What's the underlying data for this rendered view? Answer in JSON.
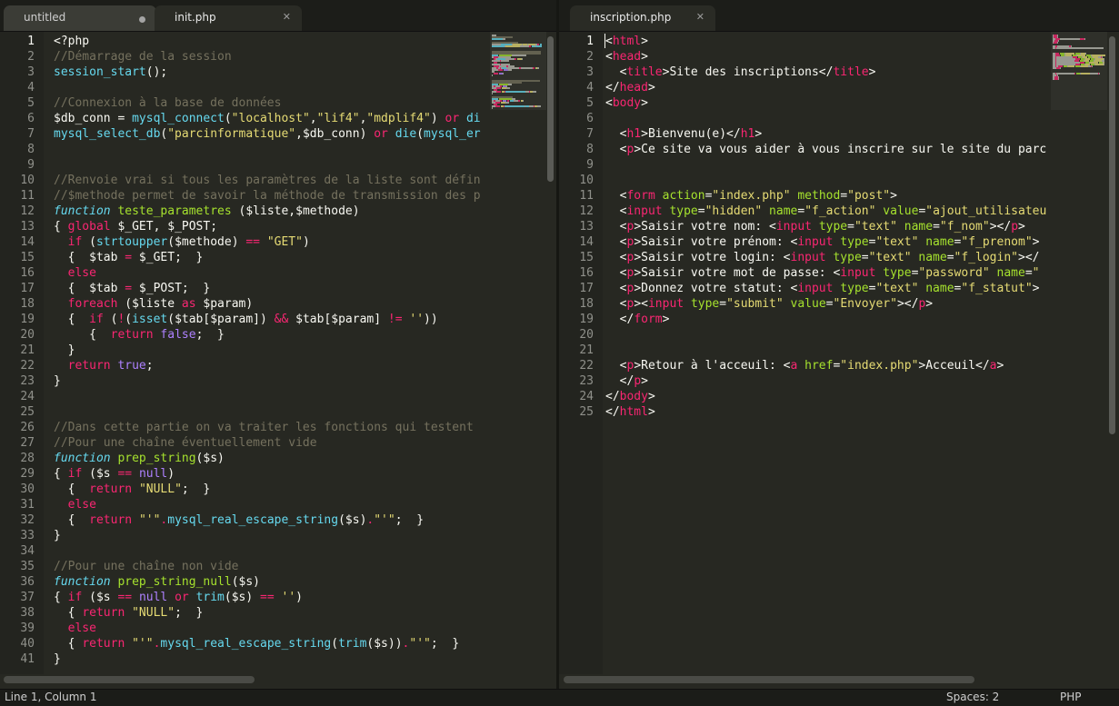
{
  "left_pane": {
    "tabs": [
      {
        "title": "untitled",
        "state": "modified"
      },
      {
        "title": "init.php",
        "state": "active"
      }
    ],
    "first_line": 1,
    "current_line": 1,
    "lines": [
      [
        [
          "t",
          "<?php"
        ]
      ],
      [
        [
          "cm",
          "//Démarrage de la session"
        ]
      ],
      [
        [
          "bi",
          "session_start"
        ],
        [
          "t",
          "();"
        ]
      ],
      [],
      [
        [
          "cm",
          "//Connexion à la base de données"
        ]
      ],
      [
        [
          "t",
          "$db_conn = "
        ],
        [
          "bi",
          "mysql_connect"
        ],
        [
          "t",
          "("
        ],
        [
          "st",
          "\"localhost\""
        ],
        [
          "t",
          ","
        ],
        [
          "st",
          "\"lif4\""
        ],
        [
          "t",
          ","
        ],
        [
          "st",
          "\"mdplif4\""
        ],
        [
          "t",
          ") "
        ],
        [
          "kw",
          "or"
        ],
        [
          "t",
          " "
        ],
        [
          "bi",
          "di"
        ]
      ],
      [
        [
          "bi",
          "mysql_select_db"
        ],
        [
          "t",
          "("
        ],
        [
          "st",
          "\"parcinformatique\""
        ],
        [
          "t",
          ",$db_conn) "
        ],
        [
          "kw",
          "or"
        ],
        [
          "t",
          " "
        ],
        [
          "bi",
          "die"
        ],
        [
          "t",
          "("
        ],
        [
          "bi",
          "mysql_er"
        ]
      ],
      [],
      [],
      [
        [
          "cm",
          "//Renvoie vrai si tous les paramètres de la liste sont défin"
        ]
      ],
      [
        [
          "cm",
          "//$methode permet de savoir la méthode de transmission des p"
        ]
      ],
      [
        [
          "bi it",
          "function"
        ],
        [
          "t",
          " "
        ],
        [
          "fn",
          "teste_parametres"
        ],
        [
          "t",
          " ($liste,$methode)"
        ]
      ],
      [
        [
          "t",
          "{ "
        ],
        [
          "kw",
          "global"
        ],
        [
          "t",
          " $_GET, $_POST;"
        ]
      ],
      [
        [
          "t",
          "  "
        ],
        [
          "kw",
          "if"
        ],
        [
          "t",
          " ("
        ],
        [
          "bi",
          "strtoupper"
        ],
        [
          "t",
          "($methode) "
        ],
        [
          "kw",
          "=="
        ],
        [
          "t",
          " "
        ],
        [
          "st",
          "\"GET\""
        ],
        [
          "t",
          ")"
        ]
      ],
      [
        [
          "t",
          "  {  $tab "
        ],
        [
          "kw",
          "="
        ],
        [
          "t",
          " $_GET;  }"
        ]
      ],
      [
        [
          "t",
          "  "
        ],
        [
          "kw",
          "else"
        ]
      ],
      [
        [
          "t",
          "  {  $tab "
        ],
        [
          "kw",
          "="
        ],
        [
          "t",
          " $_POST;  }"
        ]
      ],
      [
        [
          "t",
          "  "
        ],
        [
          "kw",
          "foreach"
        ],
        [
          "t",
          " ($liste "
        ],
        [
          "kw",
          "as"
        ],
        [
          "t",
          " $param)"
        ]
      ],
      [
        [
          "t",
          "  {  "
        ],
        [
          "kw",
          "if"
        ],
        [
          "t",
          " ("
        ],
        [
          "kw",
          "!"
        ],
        [
          "t",
          "("
        ],
        [
          "bi",
          "isset"
        ],
        [
          "t",
          "($tab[$param]) "
        ],
        [
          "kw",
          "&&"
        ],
        [
          "t",
          " $tab[$param] "
        ],
        [
          "kw",
          "!="
        ],
        [
          "t",
          " "
        ],
        [
          "st",
          "''"
        ],
        [
          "t",
          "))"
        ]
      ],
      [
        [
          "t",
          "     {  "
        ],
        [
          "kw",
          "return"
        ],
        [
          "t",
          " "
        ],
        [
          "ct",
          "false"
        ],
        [
          "t",
          ";  }"
        ]
      ],
      [
        [
          "t",
          "  }"
        ]
      ],
      [
        [
          "t",
          "  "
        ],
        [
          "kw",
          "return"
        ],
        [
          "t",
          " "
        ],
        [
          "ct",
          "true"
        ],
        [
          "t",
          ";"
        ]
      ],
      [
        [
          "t",
          "}"
        ]
      ],
      [],
      [],
      [
        [
          "cm",
          "//Dans cette partie on va traiter les fonctions qui testent"
        ]
      ],
      [
        [
          "cm",
          "//Pour une chaîne éventuellement vide"
        ]
      ],
      [
        [
          "bi it",
          "function"
        ],
        [
          "t",
          " "
        ],
        [
          "fn",
          "prep_string"
        ],
        [
          "t",
          "($s)"
        ]
      ],
      [
        [
          "t",
          "{ "
        ],
        [
          "kw",
          "if"
        ],
        [
          "t",
          " ($s "
        ],
        [
          "kw",
          "=="
        ],
        [
          "t",
          " "
        ],
        [
          "ct",
          "null"
        ],
        [
          "t",
          ")"
        ]
      ],
      [
        [
          "t",
          "  {  "
        ],
        [
          "kw",
          "return"
        ],
        [
          "t",
          " "
        ],
        [
          "st",
          "\"NULL\""
        ],
        [
          "t",
          ";  }"
        ]
      ],
      [
        [
          "t",
          "  "
        ],
        [
          "kw",
          "else"
        ]
      ],
      [
        [
          "t",
          "  {  "
        ],
        [
          "kw",
          "return"
        ],
        [
          "t",
          " "
        ],
        [
          "st",
          "\"'\""
        ],
        [
          "kw",
          "."
        ],
        [
          "bi",
          "mysql_real_escape_string"
        ],
        [
          "t",
          "($s)"
        ],
        [
          "kw",
          "."
        ],
        [
          "st",
          "\"'\""
        ],
        [
          "t",
          ";  }"
        ]
      ],
      [
        [
          "t",
          "}"
        ]
      ],
      [],
      [
        [
          "cm",
          "//Pour une chaîne non vide"
        ]
      ],
      [
        [
          "bi it",
          "function"
        ],
        [
          "t",
          " "
        ],
        [
          "fn",
          "prep_string_null"
        ],
        [
          "t",
          "($s)"
        ]
      ],
      [
        [
          "t",
          "{ "
        ],
        [
          "kw",
          "if"
        ],
        [
          "t",
          " ($s "
        ],
        [
          "kw",
          "=="
        ],
        [
          "t",
          " "
        ],
        [
          "ct",
          "null"
        ],
        [
          "t",
          " "
        ],
        [
          "kw",
          "or"
        ],
        [
          "t",
          " "
        ],
        [
          "bi",
          "trim"
        ],
        [
          "t",
          "($s) "
        ],
        [
          "kw",
          "=="
        ],
        [
          "t",
          " "
        ],
        [
          "st",
          "''"
        ],
        [
          "t",
          ")"
        ]
      ],
      [
        [
          "t",
          "  { "
        ],
        [
          "kw",
          "return"
        ],
        [
          "t",
          " "
        ],
        [
          "st",
          "\"NULL\""
        ],
        [
          "t",
          ";  }"
        ]
      ],
      [
        [
          "t",
          "  "
        ],
        [
          "kw",
          "else"
        ]
      ],
      [
        [
          "t",
          "  { "
        ],
        [
          "kw",
          "return"
        ],
        [
          "t",
          " "
        ],
        [
          "st",
          "\"'\""
        ],
        [
          "kw",
          "."
        ],
        [
          "bi",
          "mysql_real_escape_string"
        ],
        [
          "t",
          "("
        ],
        [
          "bi",
          "trim"
        ],
        [
          "t",
          "($s))"
        ],
        [
          "kw",
          "."
        ],
        [
          "st",
          "\"'\""
        ],
        [
          "t",
          ";  }"
        ]
      ],
      [
        [
          "t",
          "}"
        ]
      ]
    ]
  },
  "right_pane": {
    "tabs": [
      {
        "title": "inscription.php",
        "state": "active"
      }
    ],
    "first_line": 1,
    "current_line": 1,
    "lines": [
      [
        [
          "t",
          "<"
        ],
        [
          "kw",
          "html"
        ],
        [
          "t",
          ">"
        ]
      ],
      [
        [
          "t",
          "<"
        ],
        [
          "kw",
          "head"
        ],
        [
          "t",
          ">"
        ]
      ],
      [
        [
          "t",
          "  <"
        ],
        [
          "kw",
          "title"
        ],
        [
          "t",
          ">Site des inscriptions</"
        ],
        [
          "kw",
          "title"
        ],
        [
          "t",
          ">"
        ]
      ],
      [
        [
          "t",
          "</"
        ],
        [
          "kw",
          "head"
        ],
        [
          "t",
          ">"
        ]
      ],
      [
        [
          "t",
          "<"
        ],
        [
          "kw",
          "body"
        ],
        [
          "t",
          ">"
        ]
      ],
      [],
      [
        [
          "t",
          "  <"
        ],
        [
          "kw",
          "h1"
        ],
        [
          "t",
          ">Bienvenu(e)</"
        ],
        [
          "kw",
          "h1"
        ],
        [
          "t",
          ">"
        ]
      ],
      [
        [
          "t",
          "  <"
        ],
        [
          "kw",
          "p"
        ],
        [
          "t",
          ">Ce site va vous aider à vous inscrire sur le site du parc"
        ]
      ],
      [],
      [],
      [
        [
          "t",
          "  <"
        ],
        [
          "kw",
          "form"
        ],
        [
          "t",
          " "
        ],
        [
          "at",
          "action"
        ],
        [
          "t",
          "="
        ],
        [
          "st",
          "\"index.php\""
        ],
        [
          "t",
          " "
        ],
        [
          "at",
          "method"
        ],
        [
          "t",
          "="
        ],
        [
          "st",
          "\"post\""
        ],
        [
          "t",
          ">"
        ]
      ],
      [
        [
          "t",
          "  <"
        ],
        [
          "kw",
          "input"
        ],
        [
          "t",
          " "
        ],
        [
          "at",
          "type"
        ],
        [
          "t",
          "="
        ],
        [
          "st",
          "\"hidden\""
        ],
        [
          "t",
          " "
        ],
        [
          "at",
          "name"
        ],
        [
          "t",
          "="
        ],
        [
          "st",
          "\"f_action\""
        ],
        [
          "t",
          " "
        ],
        [
          "at",
          "value"
        ],
        [
          "t",
          "="
        ],
        [
          "st",
          "\"ajout_utilisateu"
        ]
      ],
      [
        [
          "t",
          "  <"
        ],
        [
          "kw",
          "p"
        ],
        [
          "t",
          ">Saisir votre nom: <"
        ],
        [
          "kw",
          "input"
        ],
        [
          "t",
          " "
        ],
        [
          "at",
          "type"
        ],
        [
          "t",
          "="
        ],
        [
          "st",
          "\"text\""
        ],
        [
          "t",
          " "
        ],
        [
          "at",
          "name"
        ],
        [
          "t",
          "="
        ],
        [
          "st",
          "\"f_nom\""
        ],
        [
          "t",
          "></"
        ],
        [
          "kw",
          "p"
        ],
        [
          "t",
          ">"
        ]
      ],
      [
        [
          "t",
          "  <"
        ],
        [
          "kw",
          "p"
        ],
        [
          "t",
          ">Saisir votre prénom: <"
        ],
        [
          "kw",
          "input"
        ],
        [
          "t",
          " "
        ],
        [
          "at",
          "type"
        ],
        [
          "t",
          "="
        ],
        [
          "st",
          "\"text\""
        ],
        [
          "t",
          " "
        ],
        [
          "at",
          "name"
        ],
        [
          "t",
          "="
        ],
        [
          "st",
          "\"f_prenom\""
        ],
        [
          "t",
          ">"
        ]
      ],
      [
        [
          "t",
          "  <"
        ],
        [
          "kw",
          "p"
        ],
        [
          "t",
          ">Saisir votre login: <"
        ],
        [
          "kw",
          "input"
        ],
        [
          "t",
          " "
        ],
        [
          "at",
          "type"
        ],
        [
          "t",
          "="
        ],
        [
          "st",
          "\"text\""
        ],
        [
          "t",
          " "
        ],
        [
          "at",
          "name"
        ],
        [
          "t",
          "="
        ],
        [
          "st",
          "\"f_login\""
        ],
        [
          "t",
          "></"
        ]
      ],
      [
        [
          "t",
          "  <"
        ],
        [
          "kw",
          "p"
        ],
        [
          "t",
          ">Saisir votre mot de passe: <"
        ],
        [
          "kw",
          "input"
        ],
        [
          "t",
          " "
        ],
        [
          "at",
          "type"
        ],
        [
          "t",
          "="
        ],
        [
          "st",
          "\"password\""
        ],
        [
          "t",
          " "
        ],
        [
          "at",
          "name"
        ],
        [
          "t",
          "="
        ],
        [
          "st",
          "\""
        ]
      ],
      [
        [
          "t",
          "  <"
        ],
        [
          "kw",
          "p"
        ],
        [
          "t",
          ">Donnez votre statut: <"
        ],
        [
          "kw",
          "input"
        ],
        [
          "t",
          " "
        ],
        [
          "at",
          "type"
        ],
        [
          "t",
          "="
        ],
        [
          "st",
          "\"text\""
        ],
        [
          "t",
          " "
        ],
        [
          "at",
          "name"
        ],
        [
          "t",
          "="
        ],
        [
          "st",
          "\"f_statut\""
        ],
        [
          "t",
          ">"
        ]
      ],
      [
        [
          "t",
          "  <"
        ],
        [
          "kw",
          "p"
        ],
        [
          "t",
          "><"
        ],
        [
          "kw",
          "input"
        ],
        [
          "t",
          " "
        ],
        [
          "at",
          "type"
        ],
        [
          "t",
          "="
        ],
        [
          "st",
          "\"submit\""
        ],
        [
          "t",
          " "
        ],
        [
          "at",
          "value"
        ],
        [
          "t",
          "="
        ],
        [
          "st",
          "\"Envoyer\""
        ],
        [
          "t",
          "></"
        ],
        [
          "kw",
          "p"
        ],
        [
          "t",
          ">"
        ]
      ],
      [
        [
          "t",
          "  </"
        ],
        [
          "kw",
          "form"
        ],
        [
          "t",
          ">"
        ]
      ],
      [],
      [],
      [
        [
          "t",
          "  <"
        ],
        [
          "kw",
          "p"
        ],
        [
          "t",
          ">Retour à l'acceuil: <"
        ],
        [
          "kw",
          "a"
        ],
        [
          "t",
          " "
        ],
        [
          "at",
          "href"
        ],
        [
          "t",
          "="
        ],
        [
          "st",
          "\"index.php\""
        ],
        [
          "t",
          ">Acceuil</"
        ],
        [
          "kw",
          "a"
        ],
        [
          "t",
          ">"
        ]
      ],
      [
        [
          "t",
          "  </"
        ],
        [
          "kw",
          "p"
        ],
        [
          "t",
          ">"
        ]
      ],
      [
        [
          "t",
          "</"
        ],
        [
          "kw",
          "body"
        ],
        [
          "t",
          ">"
        ]
      ],
      [
        [
          "t",
          "</"
        ],
        [
          "kw",
          "html"
        ],
        [
          "t",
          ">"
        ]
      ]
    ]
  },
  "status_bar": {
    "position": "Line 1, Column 1",
    "indentation": "Spaces: 2",
    "syntax": "PHP"
  },
  "colors": {
    "background": "#272822",
    "comment": "#75715e",
    "keyword": "#f92672",
    "string": "#e6db74",
    "function": "#a6e22e",
    "builtin": "#66d9ef",
    "constant": "#ae81ff"
  }
}
